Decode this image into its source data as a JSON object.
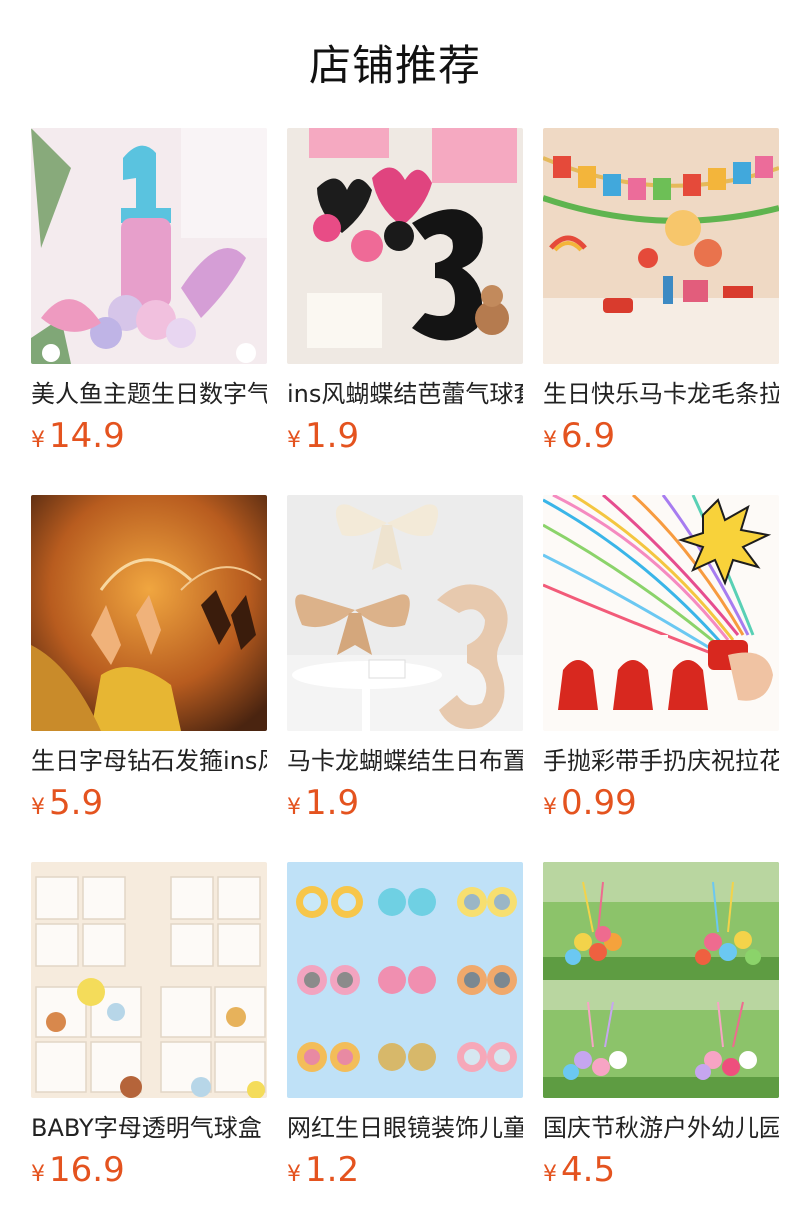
{
  "header": {
    "title": "店铺推荐"
  },
  "products": [
    {
      "title": "美人鱼主题生日数字气球",
      "currency": "¥",
      "price": "14.9",
      "image": "mermaid-number-balloon",
      "colors": [
        "#f5e9ee",
        "#6ec9df",
        "#e49fc5"
      ]
    },
    {
      "title": "ins风蝴蝶结芭蕾气球套装",
      "currency": "¥",
      "price": "1.9",
      "image": "black-heart-number-3-balloon",
      "colors": [
        "#f3eee9",
        "#1c1c1c",
        "#e94a8a"
      ]
    },
    {
      "title": "生日快乐马卡龙毛条拉旗",
      "currency": "¥",
      "price": "6.9",
      "image": "happy-birthday-banner",
      "colors": [
        "#f4e4d6",
        "#e14b3a",
        "#f5c34a"
      ]
    },
    {
      "title": "生日字母钻石发箍ins风",
      "currency": "¥",
      "price": "5.9",
      "image": "birthday-headband",
      "colors": [
        "#4e2a14",
        "#e38a2d",
        "#f2c35e"
      ]
    },
    {
      "title": "马卡龙蝴蝶结生日布置",
      "currency": "¥",
      "price": "1.9",
      "image": "bow-number-3-balloon",
      "colors": [
        "#eeeeee",
        "#e3c6a4",
        "#f6eadb"
      ]
    },
    {
      "title": "手抛彩带手扔庆祝拉花",
      "currency": "¥",
      "price": "0.99",
      "image": "hand-throw-streamer",
      "colors": [
        "#ffffff",
        "#d8281f",
        "#38b6e8"
      ]
    },
    {
      "title": "BABY字母透明气球盒",
      "currency": "¥",
      "price": "16.9",
      "image": "baby-balloon-boxes",
      "colors": [
        "#f7ecdf",
        "#ffffff",
        "#e3a15c"
      ]
    },
    {
      "title": "网红生日眼镜装饰儿童",
      "currency": "¥",
      "price": "1.2",
      "image": "birthday-glasses",
      "colors": [
        "#bfe1f7",
        "#f1c64c",
        "#f2a4b4"
      ]
    },
    {
      "title": "国庆节秋游户外幼儿园",
      "currency": "¥",
      "price": "4.5",
      "image": "balloon-bouquets-outdoor",
      "colors": [
        "#6aa64c",
        "#f4d04a",
        "#ee6b8f"
      ]
    }
  ]
}
